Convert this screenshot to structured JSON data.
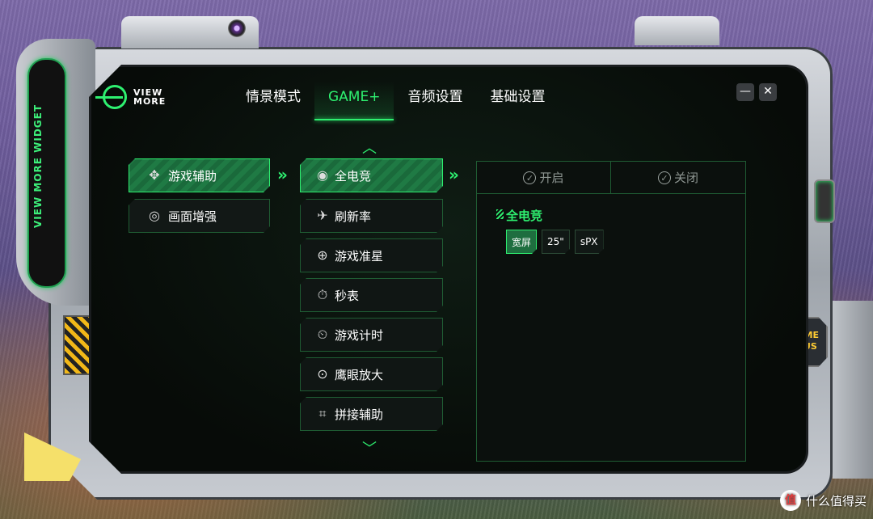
{
  "brand": {
    "line1": "VIEW",
    "line2": "MORE"
  },
  "side_label": "VIEW MORE WIDGET",
  "game_plus_label": {
    "line1": "GAME",
    "line2": "PLUS"
  },
  "nav": {
    "tabs": [
      {
        "label": "情景模式"
      },
      {
        "label": "GAME+"
      },
      {
        "label": "音频设置"
      },
      {
        "label": "基础设置"
      }
    ],
    "active": "GAME+"
  },
  "window": {
    "minimize": "—",
    "close": "✕"
  },
  "categories": [
    {
      "label": "游戏辅助",
      "icon": "gamepad-icon",
      "glyph": "✥"
    },
    {
      "label": "画面增强",
      "icon": "image-enhance-icon",
      "glyph": "◎"
    }
  ],
  "features": [
    {
      "label": "全电竞",
      "icon": "esports-icon",
      "glyph": "◉"
    },
    {
      "label": "刷新率",
      "icon": "refresh-rate-icon",
      "glyph": "✈"
    },
    {
      "label": "游戏准星",
      "icon": "crosshair-icon",
      "glyph": "⊕"
    },
    {
      "label": "秒表",
      "icon": "stopwatch-icon",
      "glyph": "⏱"
    },
    {
      "label": "游戏计时",
      "icon": "game-timer-icon",
      "glyph": "⏲"
    },
    {
      "label": "鹰眼放大",
      "icon": "magnify-icon",
      "glyph": "⊙"
    },
    {
      "label": "拼接辅助",
      "icon": "splice-icon",
      "glyph": "⌗"
    }
  ],
  "scroll": {
    "up": "︿",
    "down": "﹀"
  },
  "arrows": {
    "glyph": "»"
  },
  "panel": {
    "toggle_on": "开启",
    "toggle_off": "关闭",
    "toggle_state": "on",
    "title": "全电竞",
    "chips": [
      "宽屏",
      "25\"",
      "sPX"
    ],
    "selected_chip": "宽屏"
  },
  "watermark": {
    "icon_text": "值",
    "text": "什么值得买"
  },
  "colors": {
    "accent": "#2ef070",
    "screen_bg": "#0b100d",
    "hazard": "#f2b818"
  }
}
